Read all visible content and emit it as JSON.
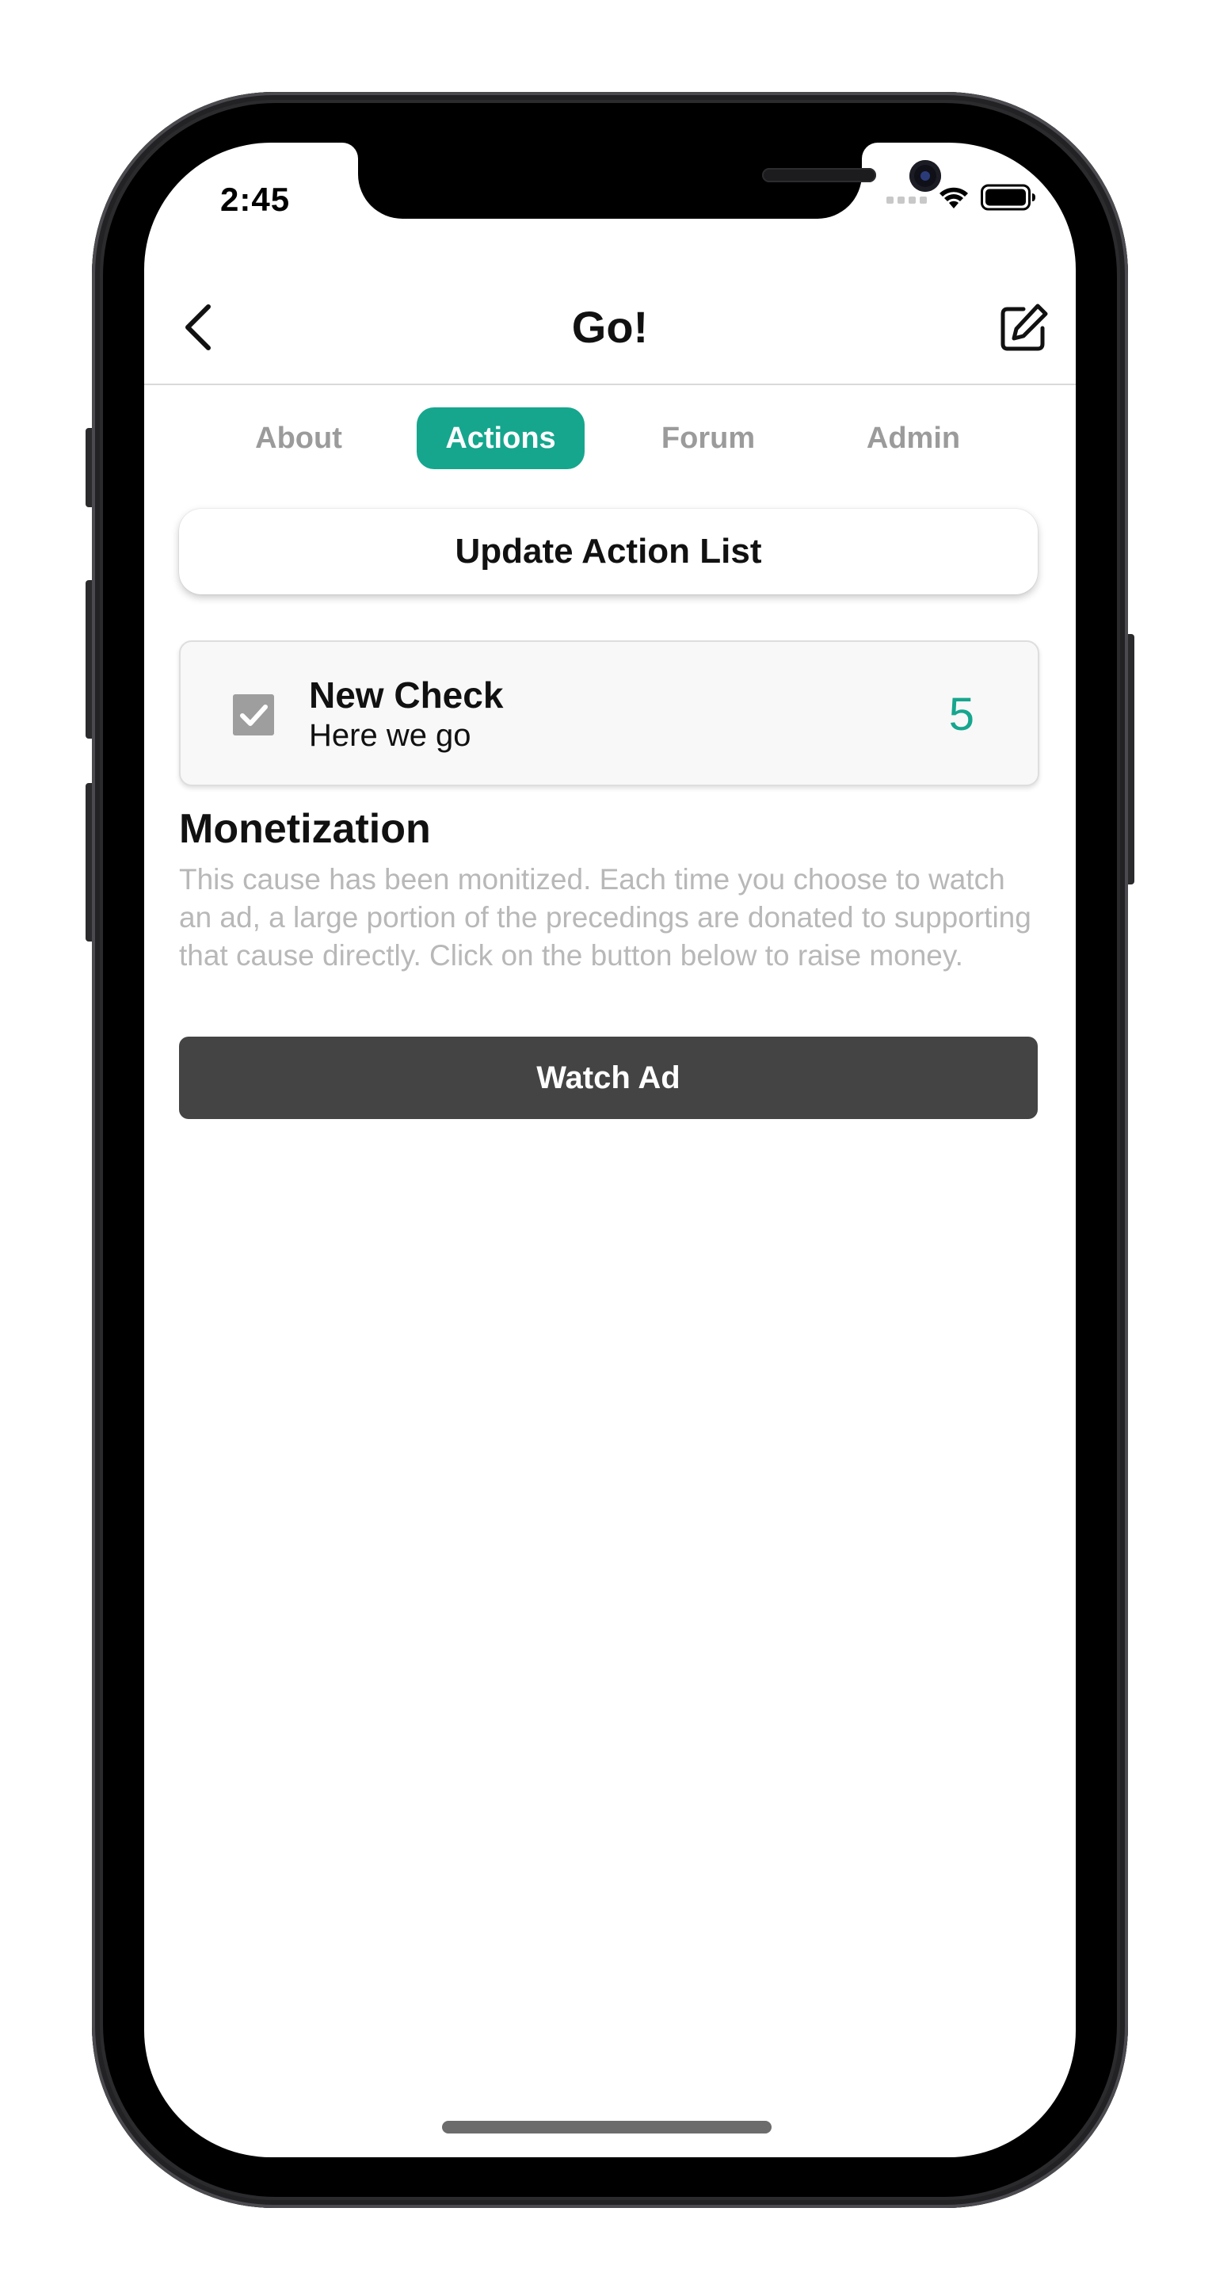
{
  "status_bar": {
    "time": "2:45"
  },
  "nav": {
    "title": "Go!",
    "back_icon": "chevron-left-icon",
    "edit_icon": "edit-icon"
  },
  "tabs": [
    {
      "label": "About",
      "active": false
    },
    {
      "label": "Actions",
      "active": true
    },
    {
      "label": "Forum",
      "active": false
    },
    {
      "label": "Admin",
      "active": false
    }
  ],
  "update_button": {
    "label": "Update Action List"
  },
  "action_item": {
    "checked": true,
    "title": "New Check",
    "subtitle": "Here we go",
    "count": "5"
  },
  "monetization": {
    "title": "Monetization",
    "description": "This cause has been monitized. Each time you choose to watch an ad, a large portion of the precedings are donated to supporting that cause directly. Click on the button below to raise money.",
    "button_label": "Watch Ad"
  },
  "colors": {
    "accent": "#16a68e",
    "dark_button": "#444444",
    "muted_text": "#b8b8b8",
    "inactive_tab": "#9b9b9b",
    "checkbox": "#9e9e9e"
  }
}
